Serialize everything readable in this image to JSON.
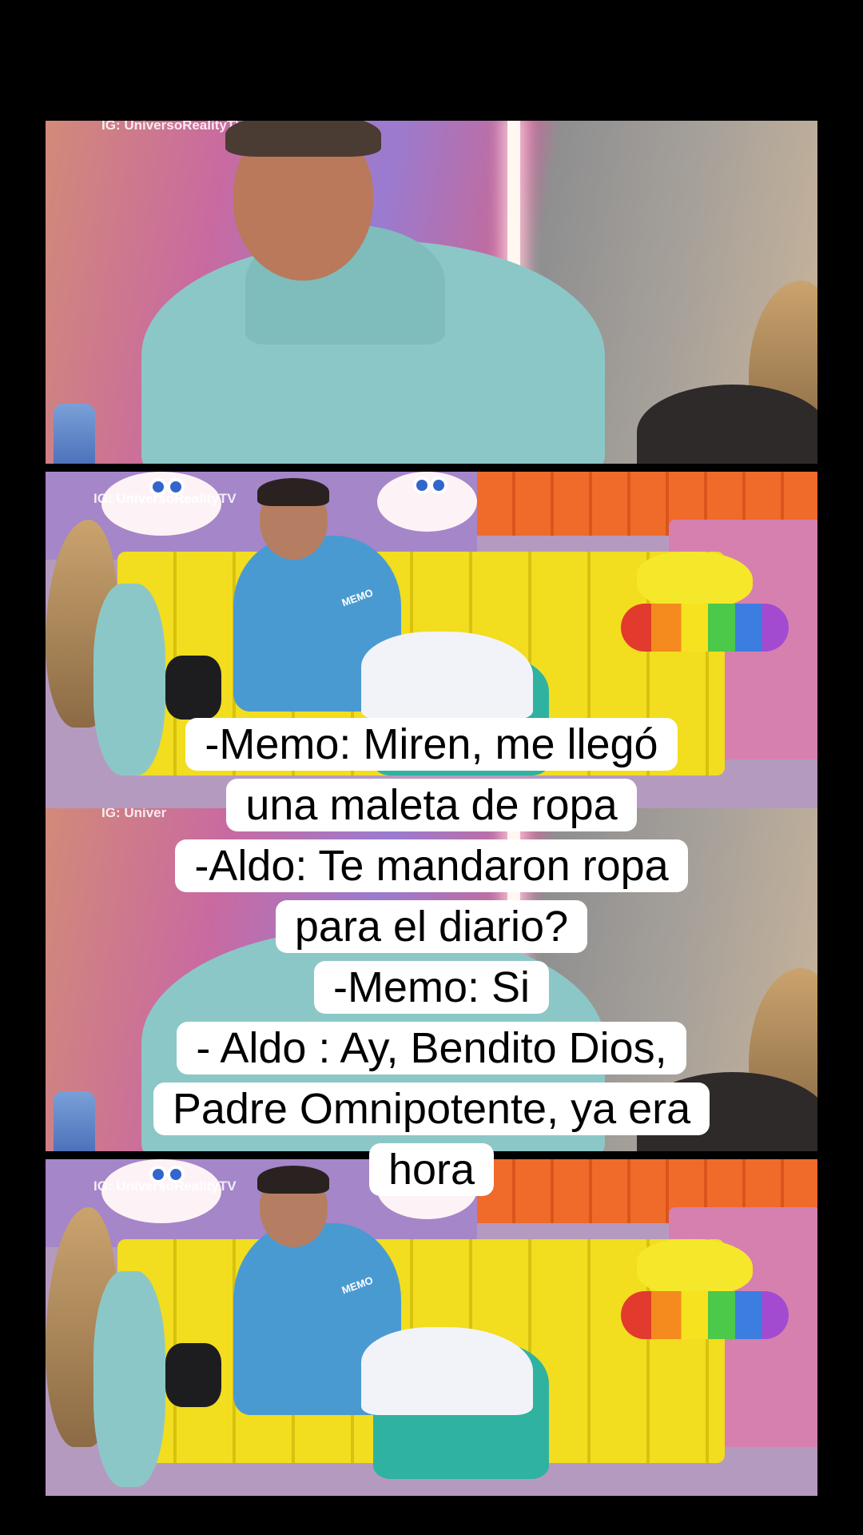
{
  "watermarks": {
    "panel1": "IG: UniversoRealityTV",
    "panel2": "IG: UniversoRealityTV",
    "panel3": "IG: Univer",
    "panel4": "IG: UniversoRealityTV"
  },
  "pillow_labels": {
    "pajama_name": "MEMO"
  },
  "caption": {
    "lines": [
      "-Memo:  Miren, me llegó",
      "una maleta de ropa",
      "-Aldo: Te mandaron ropa",
      "para el diario?",
      "-Memo: Si",
      "- Aldo : Ay, Bendito Dios,",
      "Padre Omnipotente, ya era",
      "hora"
    ]
  },
  "colors": {
    "background": "#000000",
    "caption_box": "#ffffff",
    "caption_text": "#000000"
  }
}
